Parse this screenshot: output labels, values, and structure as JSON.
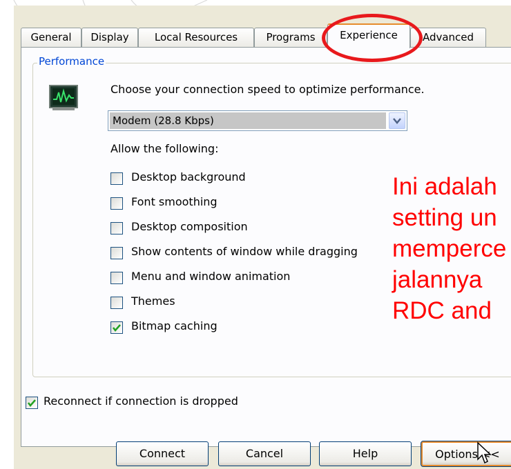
{
  "tabs": [
    {
      "label": "General",
      "active": false
    },
    {
      "label": "Display",
      "active": false
    },
    {
      "label": "Local Resources",
      "active": false
    },
    {
      "label": "Programs",
      "active": false
    },
    {
      "label": "Experience",
      "active": true
    },
    {
      "label": "Advanced",
      "active": false
    }
  ],
  "performance": {
    "group_title": "Performance",
    "icon": "monitor-icon",
    "instruction": "Choose your connection speed to optimize performance.",
    "speed_select": {
      "value": "Modem (28.8 Kbps)"
    },
    "allow_label": "Allow the following:",
    "options": [
      {
        "label": "Desktop background",
        "checked": false
      },
      {
        "label": "Font smoothing",
        "checked": false
      },
      {
        "label": "Desktop composition",
        "checked": false
      },
      {
        "label": "Show contents of window while dragging",
        "checked": false
      },
      {
        "label": "Menu and window animation",
        "checked": false
      },
      {
        "label": "Themes",
        "checked": false
      },
      {
        "label": "Bitmap caching",
        "checked": true
      }
    ]
  },
  "reconnect": {
    "label": "Reconnect if connection is dropped",
    "checked": true
  },
  "buttons": {
    "connect": "Connect",
    "cancel": "Cancel",
    "help": "Help",
    "options": "Options <<"
  },
  "annotation": {
    "color": "#FF0000",
    "lines": [
      "Ini adalah",
      "setting un",
      "memperce",
      "jalannya",
      "RDC and"
    ]
  },
  "colors": {
    "dialog_bg": "#ECE9D8",
    "panel_bg": "#FCFCFE",
    "group_title": "#0046D5",
    "highlight_ring": "#E8191C",
    "active_tab_accent": "#E68B2C"
  }
}
